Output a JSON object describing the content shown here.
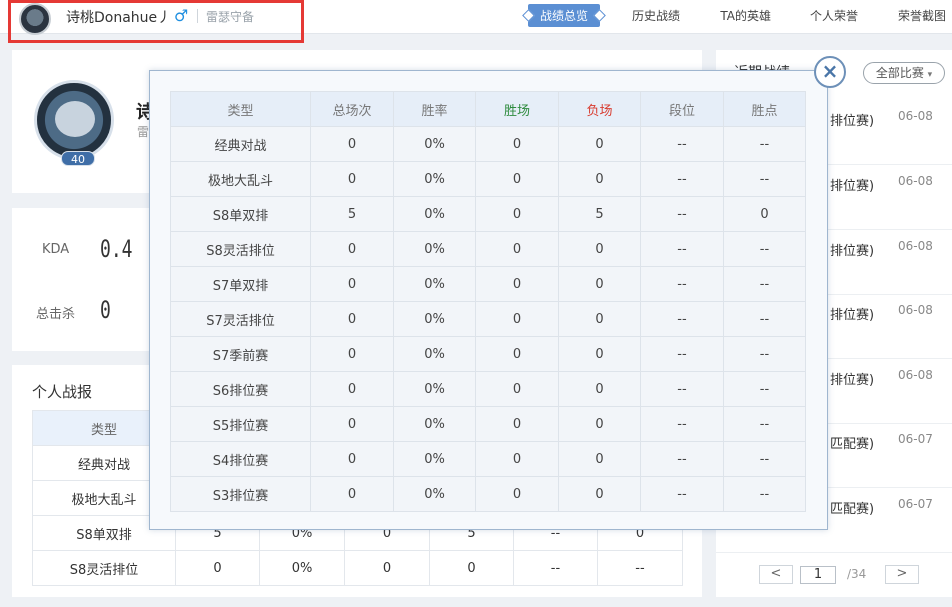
{
  "header": {
    "user_name": "诗桃Donahue丿",
    "gender_symbol": "♂",
    "server": "雷瑟守备",
    "tabs": [
      {
        "label": "战绩总览",
        "active": true
      },
      {
        "label": "历史战绩",
        "active": false
      },
      {
        "label": "TA的英雄",
        "active": false
      },
      {
        "label": "个人荣誉",
        "active": false
      },
      {
        "label": "荣誉截图",
        "active": false
      }
    ]
  },
  "profile": {
    "level": "40",
    "name_fragment": "诗",
    "sub_fragment": "雷"
  },
  "stats": {
    "kda_label": "KDA",
    "kda_value": "0.4",
    "kills_label": "总击杀",
    "kills_value": "0"
  },
  "report": {
    "title": "个人战报",
    "header_type": "类型",
    "rows": [
      {
        "type": "经典对战",
        "cells": [
          "",
          "",
          "",
          "",
          "",
          ""
        ]
      },
      {
        "type": "极地大乱斗",
        "cells": [
          "",
          "",
          "",
          "",
          "",
          ""
        ]
      },
      {
        "type": "S8单双排",
        "cells": [
          "5",
          "0%",
          "0",
          "5",
          "--",
          "0"
        ]
      },
      {
        "type": "S8灵活排位",
        "cells": [
          "0",
          "0%",
          "0",
          "0",
          "--",
          "--"
        ]
      }
    ]
  },
  "recent": {
    "title": "近期战绩",
    "filter_label": "全部比赛",
    "filter_icon": "chevron-down-icon",
    "items": [
      {
        "type": "排位赛)",
        "date": "06-08"
      },
      {
        "type": "排位赛)",
        "date": "06-08"
      },
      {
        "type": "排位赛)",
        "date": "06-08"
      },
      {
        "type": "排位赛)",
        "date": "06-08"
      },
      {
        "type": "排位赛)",
        "date": "06-08"
      },
      {
        "type": "匹配赛)",
        "date": "06-07"
      },
      {
        "type": "匹配赛)",
        "date": "06-07"
      }
    ],
    "pager": {
      "prev": "<",
      "current": "1",
      "total": "/34",
      "next": ">"
    }
  },
  "modal": {
    "close_symbol": "×",
    "headers": [
      "类型",
      "总场次",
      "胜率",
      "胜场",
      "负场",
      "段位",
      "胜点"
    ],
    "rows": [
      [
        "经典对战",
        "0",
        "0%",
        "0",
        "0",
        "--",
        "--"
      ],
      [
        "极地大乱斗",
        "0",
        "0%",
        "0",
        "0",
        "--",
        "--"
      ],
      [
        "S8单双排",
        "5",
        "0%",
        "0",
        "5",
        "--",
        "0"
      ],
      [
        "S8灵活排位",
        "0",
        "0%",
        "0",
        "0",
        "--",
        "--"
      ],
      [
        "S7单双排",
        "0",
        "0%",
        "0",
        "0",
        "--",
        "--"
      ],
      [
        "S7灵活排位",
        "0",
        "0%",
        "0",
        "0",
        "--",
        "--"
      ],
      [
        "S7季前赛",
        "0",
        "0%",
        "0",
        "0",
        "--",
        "--"
      ],
      [
        "S6排位赛",
        "0",
        "0%",
        "0",
        "0",
        "--",
        "--"
      ],
      [
        "S5排位赛",
        "0",
        "0%",
        "0",
        "0",
        "--",
        "--"
      ],
      [
        "S4排位赛",
        "0",
        "0%",
        "0",
        "0",
        "--",
        "--"
      ],
      [
        "S3排位赛",
        "0",
        "0%",
        "0",
        "0",
        "--",
        "--"
      ]
    ]
  },
  "colors": {
    "accent": "#5b8fd3",
    "win": "#2e8b3e",
    "loss": "#d83b2f",
    "highlight_box": "#e53935"
  }
}
